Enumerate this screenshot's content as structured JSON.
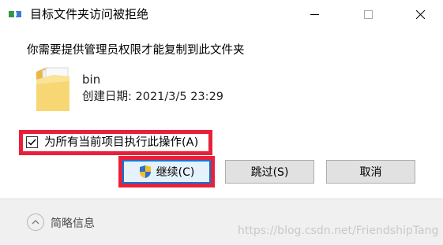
{
  "window": {
    "title": "目标文件夹访问被拒绝",
    "minimize_glyph": "—",
    "maximize_glyph": "☐",
    "close_glyph": "✕"
  },
  "message": "你需要提供管理员权限才能复制到此文件夹",
  "item": {
    "name": "bin",
    "created_label": "创建日期:",
    "created_value": "2021/3/5 23:29",
    "icon": "folder-icon"
  },
  "apply_all": {
    "label": "为所有当前项目执行此操作(A)",
    "checked": true
  },
  "buttons": {
    "continue": "继续(C)",
    "skip": "跳过(S)",
    "cancel": "取消"
  },
  "footer": {
    "details_label": "简略信息",
    "watermark": "https://blog.csdn.net/FriendshipTang"
  },
  "colors": {
    "highlight": "#e8203a",
    "focus_border": "#0078d7",
    "footer_bg": "#f0f0f0"
  }
}
